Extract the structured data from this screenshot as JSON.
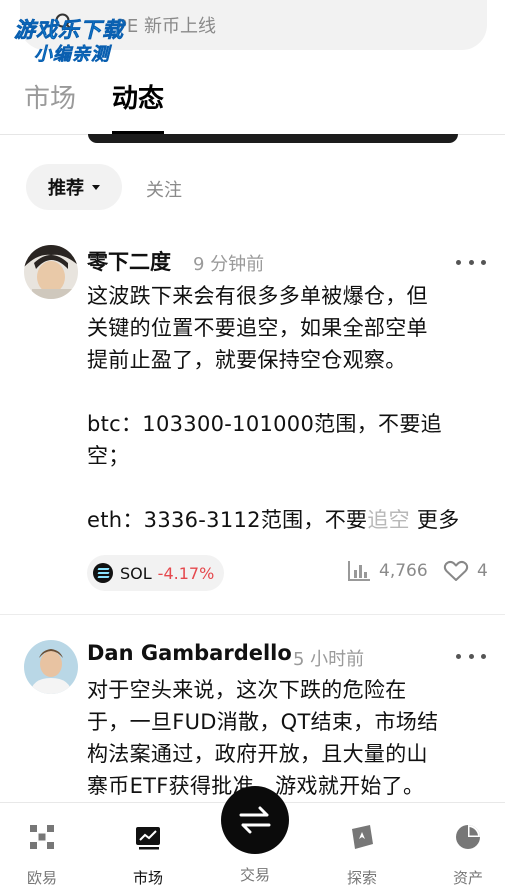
{
  "search": {
    "placeholder_text": "PE 新币上线"
  },
  "watermark": {
    "line1": "游戏乐下载",
    "line2": "小编亲测"
  },
  "tabs": [
    {
      "label": "市场",
      "active": false
    },
    {
      "label": "动态",
      "active": true
    }
  ],
  "filter": {
    "recommend_label": "推荐",
    "follow_label": "关注"
  },
  "posts": [
    {
      "author": "零下二度",
      "time": "9 分钟前",
      "lines": [
        "这波跌下来会有很多多单被爆仓，但",
        "关键的位置不要追空，如果全部空单",
        "提前止盈了，就要保持空仓观察。",
        "",
        "btc：103300-101000范围，不要追",
        "空；",
        "",
        "eth：3336-3112范围，不要"
      ],
      "last_line_faded": "追空",
      "more_label": "更多",
      "tag": {
        "symbol": "SOL",
        "change": "-4.17%"
      },
      "views": "4,766",
      "likes": "4"
    },
    {
      "author": "Dan Gambardello",
      "time": "5 小时前",
      "lines": [
        "对于空头来说，这次下跌的危险在",
        "于，一旦FUD消散，QT结束，市场结",
        "构法案通过，政府开放，且大量的山",
        "寨币ETF获得批准，游戏就开始了。"
      ]
    }
  ],
  "bottom_nav": {
    "items": [
      "欧易",
      "市场",
      "交易",
      "探索",
      "资产"
    ],
    "active_index": 1
  },
  "colors": {
    "negative": "#e5484d",
    "primary_text": "#111111",
    "muted_text": "#8a8a8a"
  }
}
